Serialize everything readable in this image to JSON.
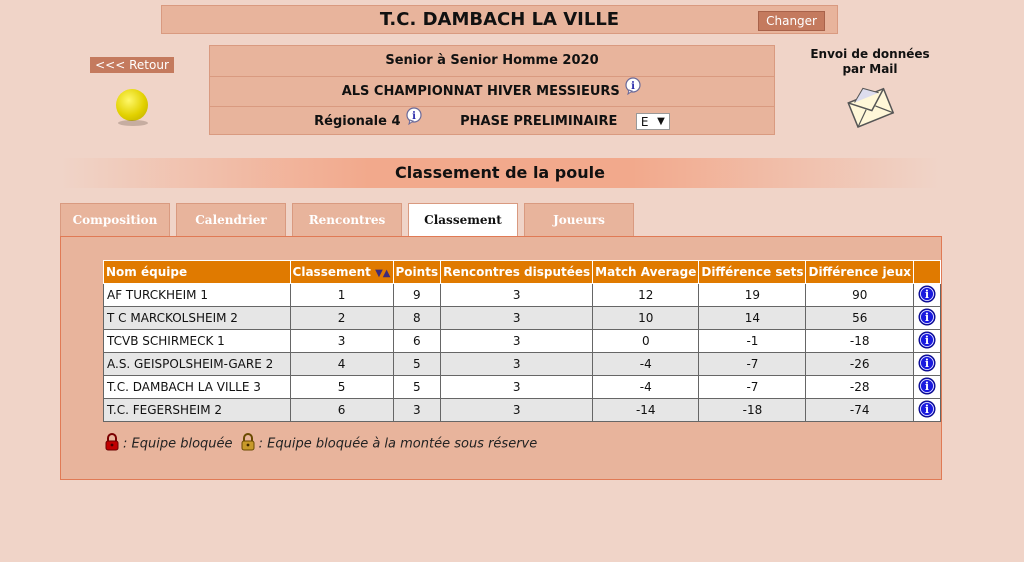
{
  "header": {
    "title": "T.C. DAMBACH LA VILLE",
    "changer_label": "Changer"
  },
  "nav": {
    "retour_label": "<<< Retour"
  },
  "info": {
    "category": "Senior  à Senior  Homme  2020",
    "championship": "ALS CHAMPIONNAT HIVER MESSIEURS",
    "division": "Régionale 4",
    "phase": "PHASE PRELIMINAIRE",
    "poule_select": "E"
  },
  "mail": {
    "line1": "Envoi de données",
    "line2": "par Mail"
  },
  "section_title": "Classement de la poule",
  "tabs": [
    {
      "label": "Composition",
      "active": false
    },
    {
      "label": "Calendrier",
      "active": false
    },
    {
      "label": "Rencontres",
      "active": false
    },
    {
      "label": "Classement",
      "active": true
    },
    {
      "label": "Joueurs",
      "active": false
    }
  ],
  "table": {
    "headers": [
      "Nom équipe",
      "Classement",
      "Points",
      "Rencontres disputées",
      "Match Average",
      "Différence sets",
      "Différence jeux"
    ],
    "rows": [
      [
        "AF TURCKHEIM 1",
        "1",
        "9",
        "3",
        "12",
        "19",
        "90"
      ],
      [
        "T C MARCKOLSHEIM 2",
        "2",
        "8",
        "3",
        "10",
        "14",
        "56"
      ],
      [
        "TCVB SCHIRMECK 1",
        "3",
        "6",
        "3",
        "0",
        "-1",
        "-18"
      ],
      [
        "A.S. GEISPOLSHEIM-GARE 2",
        "4",
        "5",
        "3",
        "-4",
        "-7",
        "-26"
      ],
      [
        "T.C. DAMBACH LA VILLE 3",
        "5",
        "5",
        "3",
        "-4",
        "-7",
        "-28"
      ],
      [
        "T.C. FEGERSHEIM 2",
        "6",
        "3",
        "3",
        "-14",
        "-18",
        "-74"
      ]
    ]
  },
  "legend": {
    "locked": ": Equipe bloquée",
    "locked_reserve": ": Equipe bloquée à la montée sous réserve"
  },
  "colors": {
    "header_orange": "#e07a00",
    "tab_bg": "#e8b49c",
    "panel_border": "#e07a55",
    "info_blue": "#1a1adf"
  }
}
